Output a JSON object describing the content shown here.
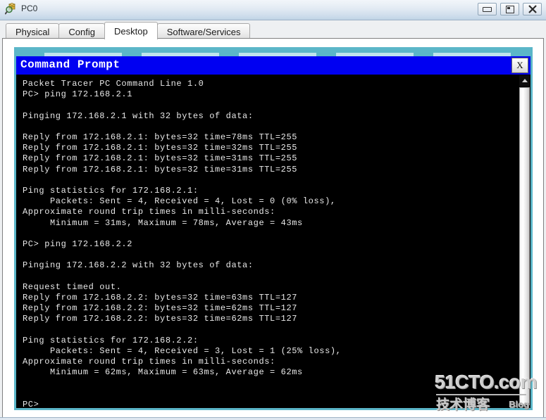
{
  "window": {
    "title": "PC0",
    "icon": "packet-tracer-icon",
    "controls": {
      "minimize_label": "Minimize",
      "maximize_label": "Maximize",
      "close_label": "Close"
    }
  },
  "tabs": [
    {
      "label": "Physical",
      "active": false
    },
    {
      "label": "Config",
      "active": false
    },
    {
      "label": "Desktop",
      "active": true
    },
    {
      "label": "Software/Services",
      "active": false
    }
  ],
  "command_prompt": {
    "title": "Command Prompt",
    "close_label": "X",
    "title_bg": "#0000f2",
    "frame_color": "#5bb6c8",
    "terminal_bg": "#000000",
    "terminal_fg": "#e8e8e8",
    "lines": [
      "Packet Tracer PC Command Line 1.0",
      "PC> ping 172.168.2.1",
      "",
      "Pinging 172.168.2.1 with 32 bytes of data:",
      "",
      "Reply from 172.168.2.1: bytes=32 time=78ms TTL=255",
      "Reply from 172.168.2.1: bytes=32 time=32ms TTL=255",
      "Reply from 172.168.2.1: bytes=32 time=31ms TTL=255",
      "Reply from 172.168.2.1: bytes=32 time=31ms TTL=255",
      "",
      "Ping statistics for 172.168.2.1:",
      "     Packets: Sent = 4, Received = 4, Lost = 0 (0% loss),",
      "Approximate round trip times in milli-seconds:",
      "     Minimum = 31ms, Maximum = 78ms, Average = 43ms",
      "",
      "PC> ping 172.168.2.2",
      "",
      "Pinging 172.168.2.2 with 32 bytes of data:",
      "",
      "Request timed out.",
      "Reply from 172.168.2.2: bytes=32 time=63ms TTL=127",
      "Reply from 172.168.2.2: bytes=32 time=62ms TTL=127",
      "Reply from 172.168.2.2: bytes=32 time=62ms TTL=127",
      "",
      "Ping statistics for 172.168.2.2:",
      "     Packets: Sent = 4, Received = 3, Lost = 1 (25% loss),",
      "Approximate round trip times in milli-seconds:",
      "     Minimum = 62ms, Maximum = 63ms, Average = 62ms",
      "",
      "",
      "PC>"
    ],
    "scrollbar": {
      "up_arrow": "scroll-up-arrow"
    }
  },
  "watermark": {
    "main": "51CTO.com",
    "chinese": "技术博客",
    "blog": "Blog"
  }
}
